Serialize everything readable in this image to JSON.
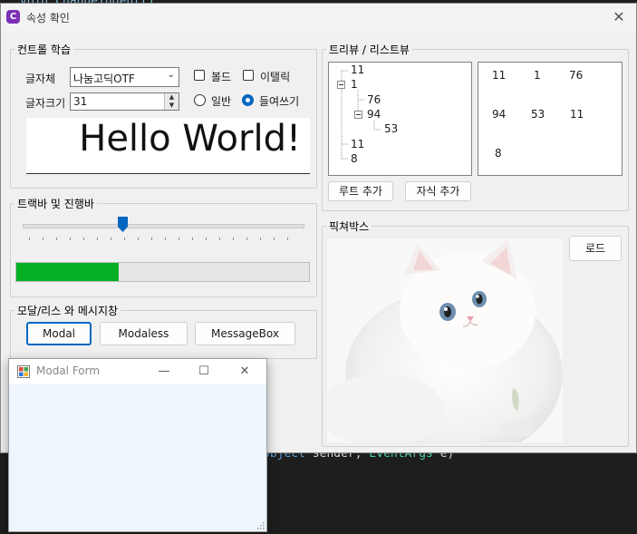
{
  "background_code": {
    "top_line": "void ChangeIndent()",
    "mid_keyword": "object",
    "mid_name": " sender, ",
    "mid_type": "EventArgs",
    "mid_rest": " e)"
  },
  "window": {
    "title": "속성 확인",
    "icon_glyph": "C"
  },
  "font_group": {
    "legend": "컨트롤 학습",
    "font_label": "글자체",
    "font_value": "나눔고딕OTF",
    "size_label": "글자크기",
    "size_value": "31",
    "bold_label": "볼드",
    "italic_label": "이탤릭",
    "normal_label": "일반",
    "indent_label": "들여쓰기",
    "bold_checked": false,
    "italic_checked": false,
    "selected_radio": "indent",
    "preview_text": "Hello World!"
  },
  "track_group": {
    "legend": "트랙바 및 진행바",
    "progress_fraction": 0.35,
    "track_fraction": 0.36
  },
  "modal_group": {
    "legend": "모달/리스 와 메시지창",
    "modal_label": "Modal",
    "modaless_label": "Modaless",
    "messagebox_label": "MessageBox"
  },
  "tree_group": {
    "legend": "트리뷰 / 리스트뷰",
    "tree_nodes": [
      "11",
      "1",
      "76",
      "94",
      "53",
      "11",
      "8"
    ],
    "list_items": [
      "11",
      "1",
      "76",
      "94",
      "53",
      "11",
      "8"
    ],
    "root_add_label": "루트 추가",
    "child_add_label": "자식 추가"
  },
  "picture_group": {
    "legend": "픽쳐박스",
    "load_label": "로드"
  },
  "modal_form": {
    "title": "Modal Form"
  },
  "colors": {
    "accent": "#0067c0",
    "progress": "#06b025",
    "app_icon": "#7b2fb5"
  }
}
